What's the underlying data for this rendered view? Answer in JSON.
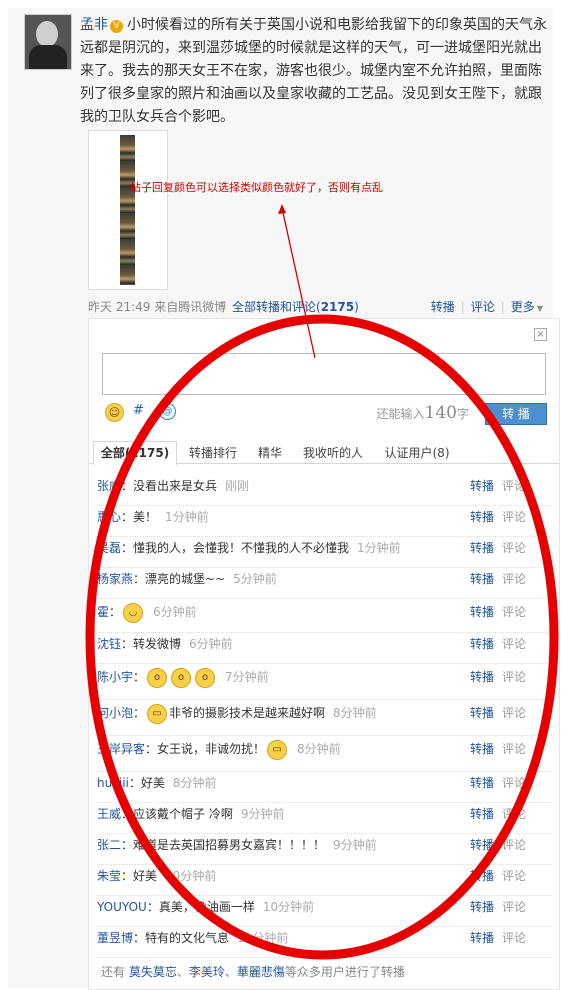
{
  "post": {
    "author": "孟非",
    "text": "小时候看过的所有关于英国小说和电影给我留下的印象英国的天气永远都是阴沉的，来到温莎城堡的时候就是这样的天气，可一进城堡阳光就出来了。我去的那天女王不在家，游客也很少。城堡内室不允许拍照，里面陈列了很多皇家的照片和油画以及皇家收藏的工艺品。没见到女王陛下，就跟我的卫队女兵合个影吧。",
    "annotation": "帖子回复颜色可以选择类似颜色就好了，否则有点乱",
    "source": "昨天 21:49 来自腾讯微博",
    "count_label": "全部转播和评论(",
    "count": "2175",
    "count_close": ")",
    "actions": [
      "转播",
      "评论",
      "更多"
    ]
  },
  "icons": {
    "verified": "verified-badge-icon",
    "close": "close-icon",
    "emoticon": "smiley-icon",
    "topic": "hash-topic-icon",
    "mention": "at-icon"
  },
  "composer": {
    "close": "×",
    "remain_label": "还能输入",
    "remain_count": "140",
    "remain_unit": "字",
    "submit": "转 播",
    "emo1": "☺",
    "emo2": "#",
    "emo3": "@"
  },
  "tabs": [
    "全部(2175)",
    "转播排行",
    "精华",
    "我收听的人",
    "认证用户(8)"
  ],
  "rows": [
    {
      "user": "张威",
      "text": "没看出来是女兵",
      "time": "刚刚",
      "act": "转播",
      "cmt": "评论"
    },
    {
      "user": "惠心",
      "text": "美！",
      "time": "1分钟前",
      "act": "转播",
      "cmt": "评论"
    },
    {
      "user": "吴磊",
      "text": "懂我的人，会懂我！不懂我的人不必懂我",
      "time": "1分钟前",
      "act": "转播",
      "cmt": "评论"
    },
    {
      "user": "杨家燕",
      "text": "漂亮的城堡~~",
      "time": "5分钟前",
      "act": "转播",
      "cmt": "评论"
    },
    {
      "user": "霍",
      "text": "",
      "emojis": 1,
      "time": "6分钟前",
      "act": "转播",
      "cmt": "评论"
    },
    {
      "user": "沈钰",
      "text": "转发微博",
      "time": "6分钟前",
      "act": "转播",
      "cmt": "评论"
    },
    {
      "user": "陈小宇",
      "text": "",
      "emojis": 3,
      "time": "7分钟前",
      "act": "转播",
      "cmt": "评论"
    },
    {
      "user": "何小泡",
      "text": "非爷的摄影技术是越来越好啊",
      "emojis_before": 1,
      "time": "8分钟前",
      "act": "转播",
      "cmt": "评论"
    },
    {
      "user": "王岸异客",
      "text": "女王说，非诚勿扰！",
      "emojis": 1,
      "time": "8分钟前",
      "act": "转播",
      "cmt": "评论"
    },
    {
      "user": "huijiii",
      "text": "好美",
      "time": "8分钟前",
      "act": "转播",
      "cmt": "评论"
    },
    {
      "user": "王威",
      "text": "应该戴个帽子 冷啊",
      "time": "9分钟前",
      "act": "转播",
      "cmt": "评论"
    },
    {
      "user": "张二",
      "text": "难道是去英国招募男女嘉宾！！！！",
      "time": "9分钟前",
      "act": "转播",
      "cmt": "评论"
    },
    {
      "user": "朱莹",
      "text": "好美",
      "time": "10分钟前",
      "act": "转播",
      "cmt": "评论"
    },
    {
      "user": "YOUYOU",
      "text": "真美，像油画一样",
      "time": "10分钟前",
      "act": "转播",
      "cmt": "评论"
    },
    {
      "user": "董昱博",
      "text": "特有的文化气息",
      "time": "11分钟前",
      "act": "转播",
      "cmt": "评论"
    }
  ],
  "footer": {
    "prefix": "还有",
    "users": [
      "莫失莫忘",
      "李美玲",
      "華麗悲傷"
    ],
    "suffix": "等众多用户进行了转播",
    "sep": "、"
  },
  "colors": {
    "link": "#225599",
    "annotation": "#d00000",
    "button": "#4d8fd3"
  }
}
